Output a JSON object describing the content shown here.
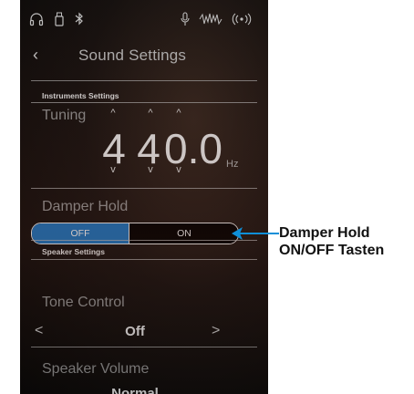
{
  "status_bar": {
    "icons": [
      "headphones-icon",
      "usb-icon",
      "bluetooth-icon",
      "microphone-icon",
      "recorder-icon",
      "wireless-icon"
    ]
  },
  "header": {
    "back_icon": "‹",
    "title": "Sound Settings"
  },
  "instruments_settings": {
    "section_label": "Instruments Settings",
    "tuning": {
      "label": "Tuning",
      "digits": [
        "4",
        "4",
        "0.0"
      ],
      "unit": "Hz",
      "up_arrow": "^",
      "down_arrow": "v"
    },
    "damper_hold": {
      "label": "Damper Hold",
      "off_label": "OFF",
      "on_label": "ON",
      "selected": "OFF",
      "active_color": "#1d76c2"
    }
  },
  "speaker_settings": {
    "section_label": "Speaker Settings",
    "tone_control": {
      "label": "Tone Control",
      "value": "Off",
      "prev": "<",
      "next": ">"
    },
    "speaker_volume": {
      "label": "Speaker Volume",
      "value": "Normal"
    }
  },
  "annotation": {
    "line1": "Damper Hold",
    "line2": "ON/OFF Tasten",
    "arrow_color": "#0f8fd8"
  }
}
